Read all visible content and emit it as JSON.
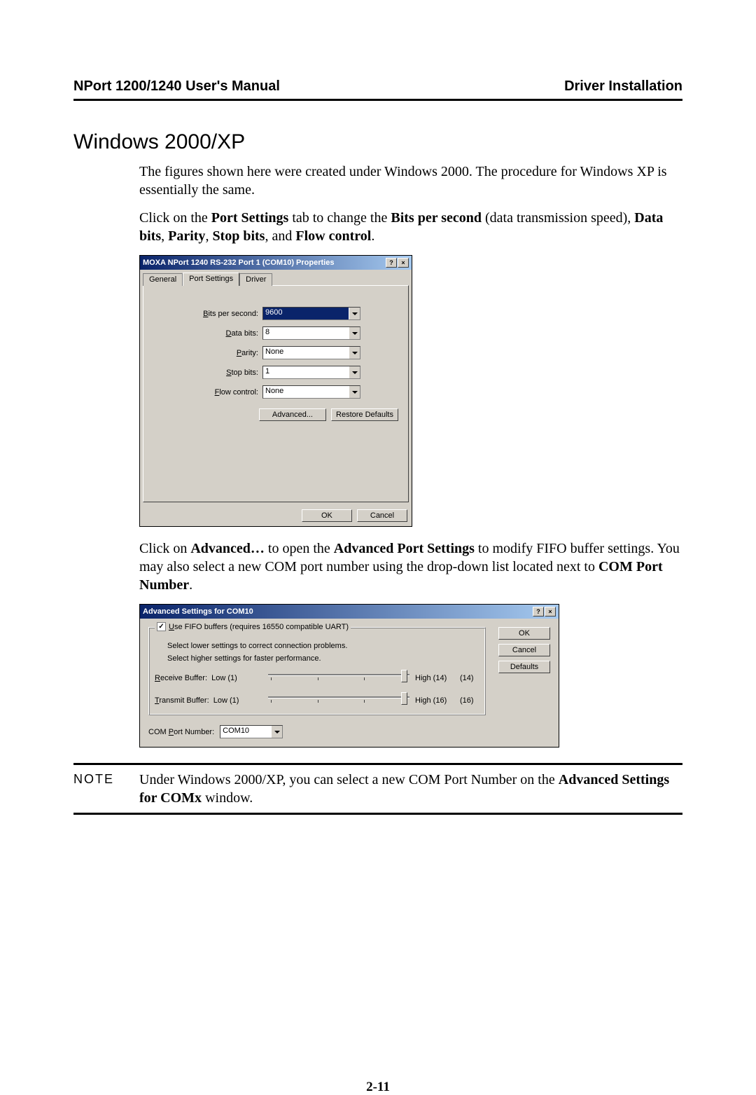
{
  "header": {
    "title": "NPort 1200/1240 User's Manual",
    "section": "Driver Installation"
  },
  "section_heading": "Windows 2000/XP",
  "para1": "The figures shown here were created under Windows 2000. The procedure for Windows XP is essentially the same.",
  "para2": {
    "pre": "Click on the ",
    "b1": "Port Settings",
    "mid1": " tab to change the ",
    "b2": "Bits per second",
    "mid2": " (data transmission speed), ",
    "b3": "Data bits",
    "mid3": ", ",
    "b4": "Parity",
    "mid4": ", ",
    "b5": "Stop bits",
    "mid5": ", and ",
    "b6": "Flow control",
    "end": "."
  },
  "dlg1": {
    "title": "MOXA NPort 1240 RS-232 Port 1 (COM10) Properties",
    "tabs": {
      "general": "General",
      "port_settings": "Port Settings",
      "driver": "Driver"
    },
    "fields": {
      "bps": {
        "label": "Bits per second:",
        "value": "9600"
      },
      "databits": {
        "label": "Data bits:",
        "value": "8"
      },
      "parity": {
        "label": "Parity:",
        "value": "None"
      },
      "stopbits": {
        "label": "Stop bits:",
        "value": "1"
      },
      "flow": {
        "label": "Flow control:",
        "value": "None"
      }
    },
    "buttons": {
      "advanced": "Advanced...",
      "restore": "Restore Defaults",
      "ok": "OK",
      "cancel": "Cancel"
    }
  },
  "para3": {
    "pre": "Click on ",
    "b1": "Advanced…",
    "mid1": " to open the ",
    "b2": "Advanced Port Settings",
    "mid2": " to modify FIFO buffer settings. You may also select a new COM port number using the drop-down list located next to ",
    "b3": "COM Port Number",
    "end": "."
  },
  "dlg2": {
    "title": "Advanced Settings for COM10",
    "fifo_label": "Use FIFO buffers (requires 16550 compatible UART)",
    "line1": "Select lower settings to correct connection problems.",
    "line2": "Select higher settings for faster performance.",
    "recv": {
      "label": "Receive Buffer:",
      "low": "Low (1)",
      "high": "High (14)",
      "value": "(14)"
    },
    "xmit": {
      "label": "Transmit Buffer:",
      "low": "Low (1)",
      "high": "High (16)",
      "value": "(16)"
    },
    "comport": {
      "label": "COM Port Number:",
      "value": "COM10"
    },
    "buttons": {
      "ok": "OK",
      "cancel": "Cancel",
      "defaults": "Defaults"
    }
  },
  "note": {
    "label": "NOTE",
    "pre": "Under Windows 2000/XP, you can select a new COM Port Number on the ",
    "b1": "Advanced Settings for COMx",
    "end": " window."
  },
  "page_number": "2-11"
}
